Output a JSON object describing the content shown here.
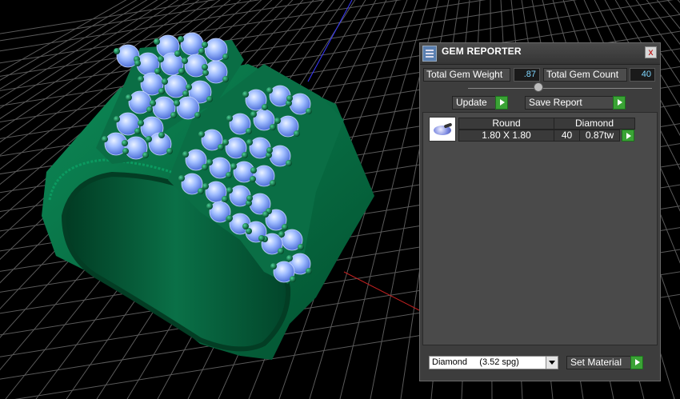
{
  "panel": {
    "title": "GEM REPORTER",
    "close_label": "x",
    "total_weight_label": "Total Gem Weight",
    "total_weight_value": ".87",
    "total_count_label": "Total Gem Count",
    "total_count_value": "40",
    "update_label": "Update",
    "save_report_label": "Save Report",
    "report_row": {
      "shape": "Round",
      "material": "Diamond",
      "size": "1.80 X 1.80",
      "count": "40",
      "weight": "0.87tw"
    },
    "material_select_value": "Diamond     (3.52 spg)",
    "set_material_label": "Set Material"
  },
  "colors": {
    "ring_metal": "#0a7a4d",
    "gem_blue": "#8fb3ff",
    "accent_green": "#3aa335",
    "value_text": "#7fd7ff"
  }
}
